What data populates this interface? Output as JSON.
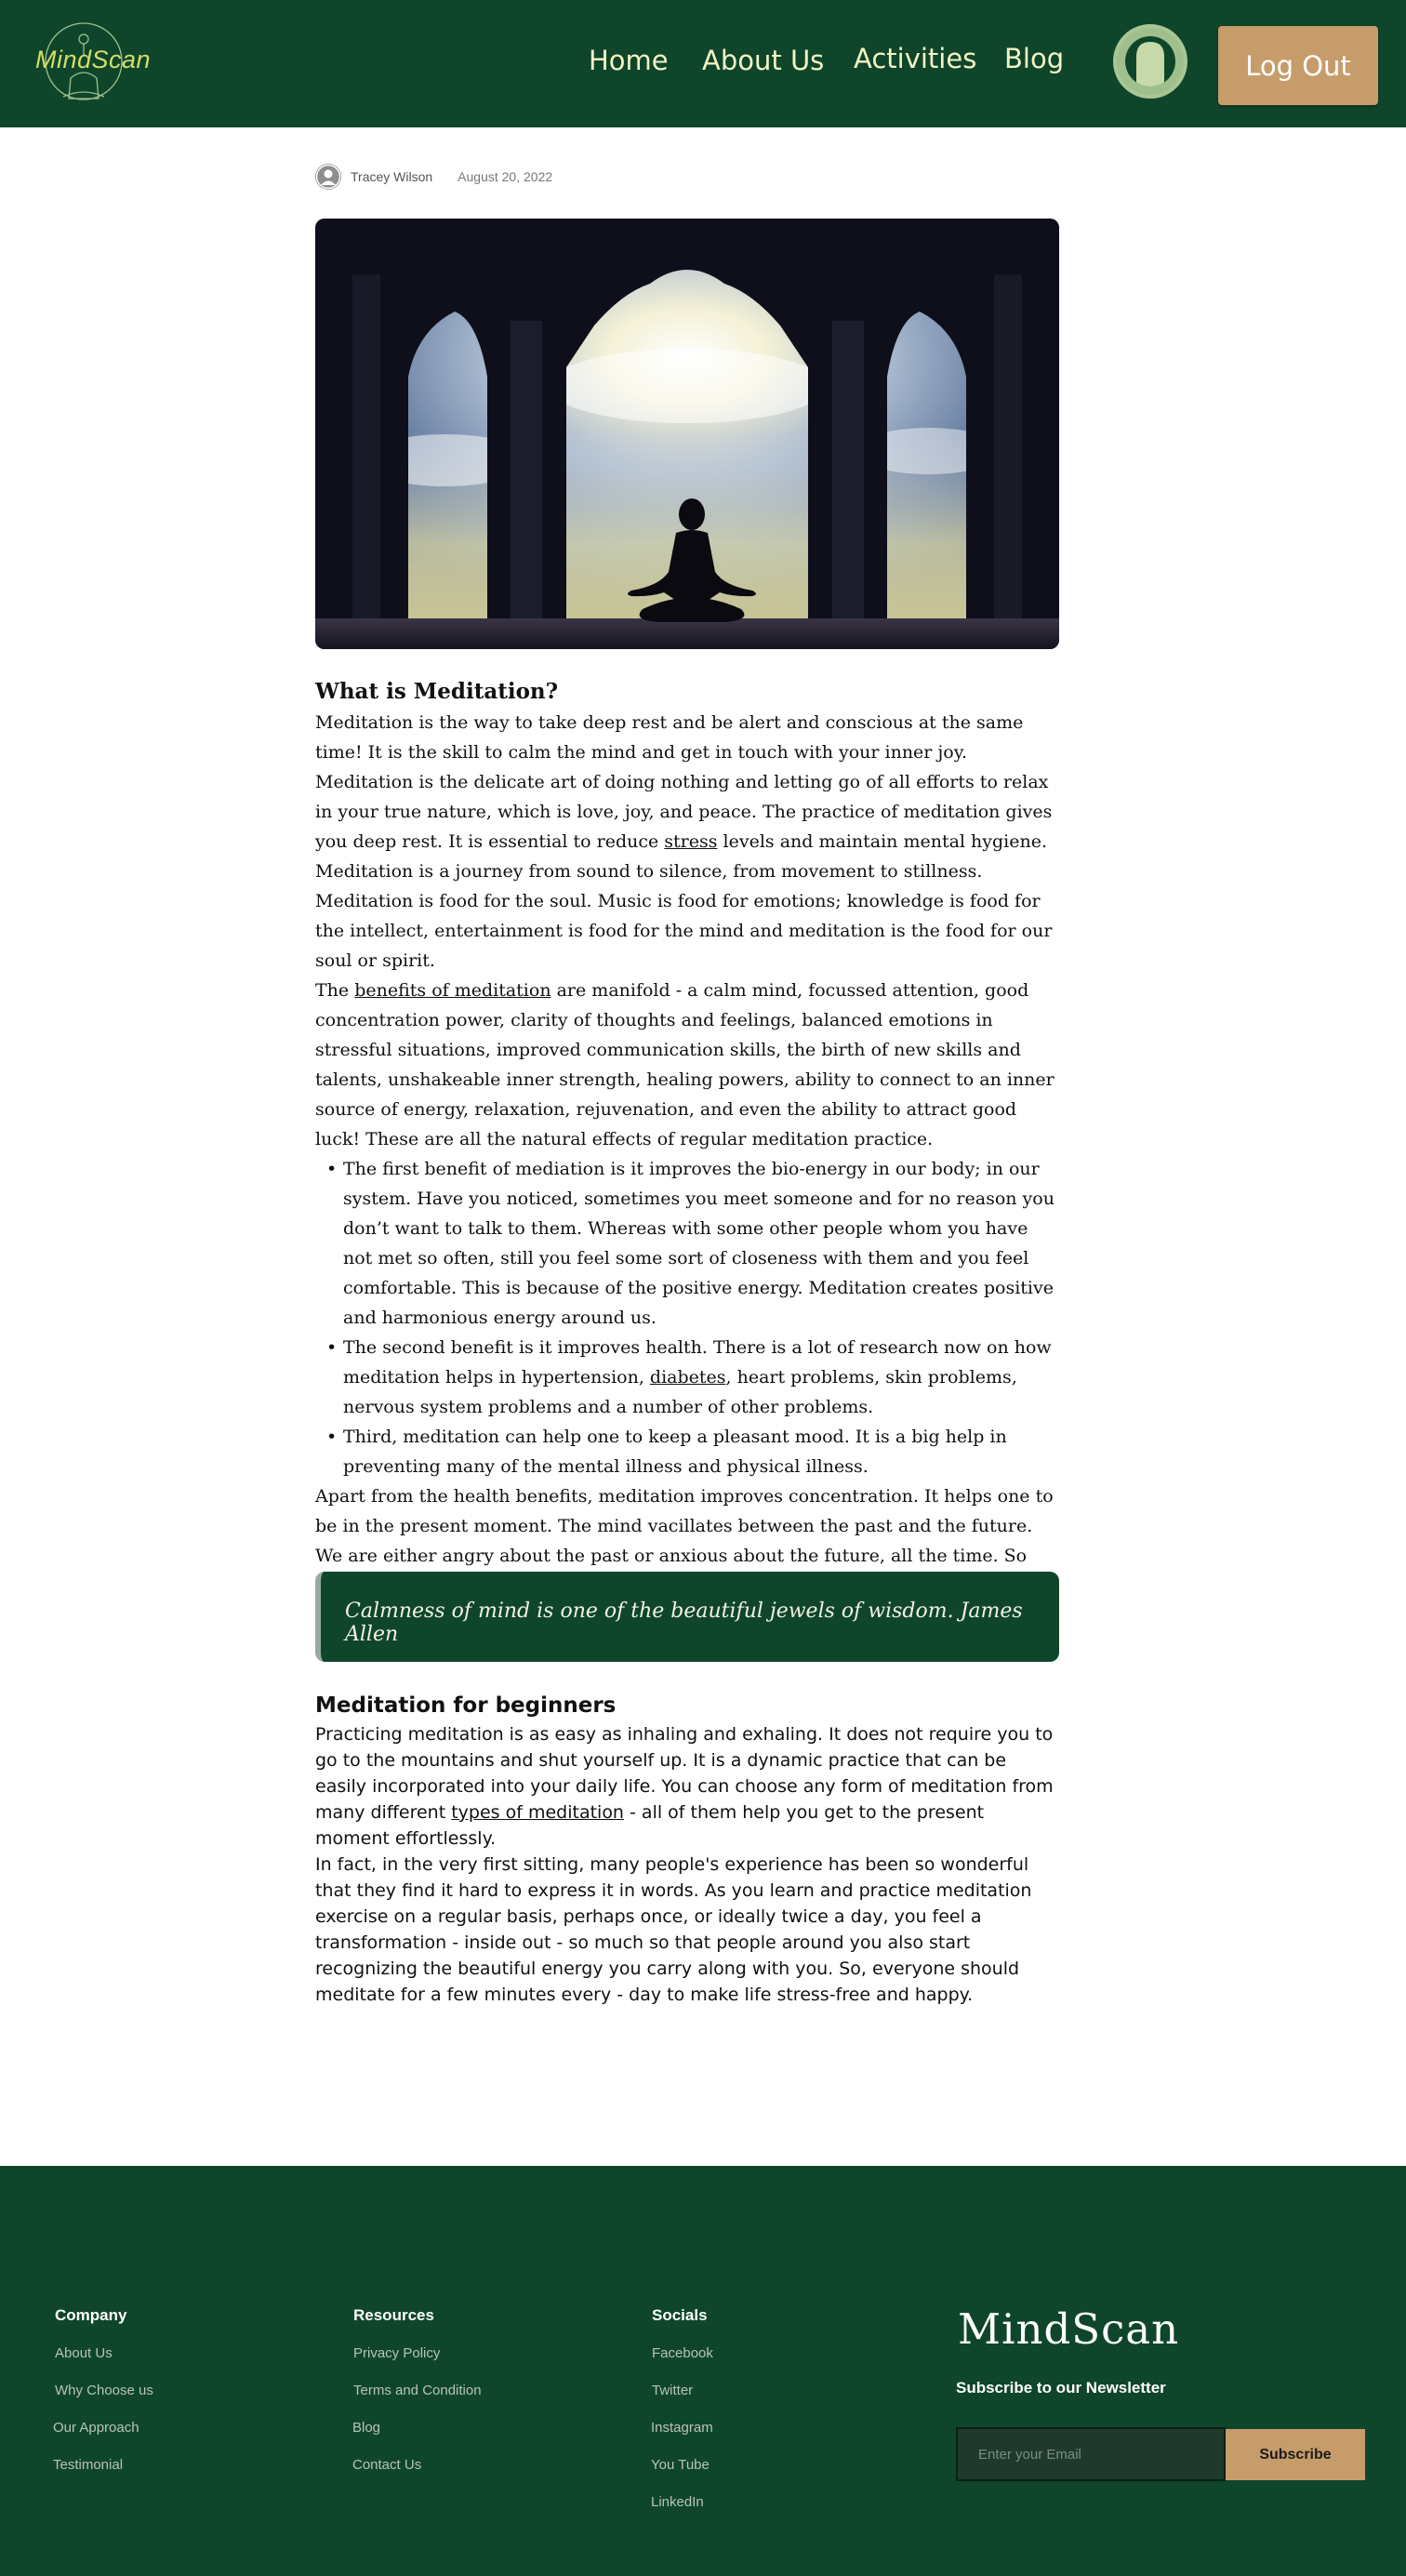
{
  "header": {
    "logo_text": "MindScan",
    "nav": {
      "home": "Home",
      "about": "About Us",
      "activities": "Activities",
      "blog": "Blog"
    },
    "logout_label": "Log Out"
  },
  "post": {
    "author": "Tracey Wilson",
    "date": "August 20, 2022"
  },
  "article": {
    "heading": "What is Meditation?",
    "p1_before": "Meditation is the way to take deep rest and be alert and conscious at the same time! It is the skill to calm the mind and get in touch with your inner joy. Meditation is the delicate art of doing nothing and letting go of all efforts to relax in your true nature, which is love, joy, and peace. The practice of meditation gives you deep rest. It is essential to reduce ",
    "p1_link": "stress",
    "p1_after": " levels and maintain mental hygiene.",
    "p2": "Meditation is a journey from sound to silence, from movement to stillness. Meditation is food for the soul. Music is food for emotions; knowledge is food for the intellect, entertainment is food for the mind and meditation is the food for our soul or spirit.",
    "p3_before": "The ",
    "p3_link": "benefits of meditation",
    "p3_after": " are manifold - a calm mind, focussed attention, good concentration power, clarity of thoughts and feelings, balanced emotions in stressful situations, improved communication skills, the birth of new skills and talents, unshakeable inner strength, healing powers, ability to connect to an inner source of energy, relaxation, rejuvenation, and even the ability to attract good luck! These are all the natural effects of regular meditation practice.",
    "b1": "The first benefit of mediation is it improves the bio-energy in our body; in our system. Have you noticed, sometimes you meet someone and for no reason you don’t want to talk to them. Whereas with some other people whom you have not met so often, still you feel some sort of closeness with them and you feel comfortable. This is because of the positive energy. Meditation creates positive and harmonious energy around us.",
    "b2_before": "The second benefit is it improves health. There is a lot of research now on how meditation helps in hypertension, ",
    "b2_link": "diabetes",
    "b2_after": ", heart problems, skin problems, nervous system problems and a number of other problems.",
    "b3": "Third, meditation can help one to keep a pleasant mood. It is a big help in preventing many of the mental illness and physical illness.",
    "p4": "Apart from the health benefits, meditation improves concentration. It helps one to be in the present moment. The mind vacillates between the past and the future. We are either angry about the past or anxious about the future, all the time. So meditation helps keep the mind from swinging between the past and the future to be more in the present."
  },
  "quote": "Calmness of mind is one of the beautiful jewels of wisdom. James Allen",
  "beginners": {
    "heading": "Meditation for beginners",
    "p1_before": "Practicing meditation is as easy as inhaling and exhaling. It does not require you to go to the mountains and shut yourself up. It is a dynamic practice that can be easily incorporated into your daily life. You can choose any form of meditation from many different ",
    "p1_link": "types of meditation",
    "p1_after": " - all of them help you get to the present moment effortlessly.",
    "p2": "In fact, in the very first sitting, many people's experience has been so wonderful that they find it hard to express it in words. As you learn and practice meditation exercise on a regular basis, perhaps once, or ideally twice a day, you feel a transformation - inside out - so much so that people around you also start recognizing the beautiful energy you carry along with you. So, everyone should meditate for a few minutes every - day to make life stress-free and happy."
  },
  "footer": {
    "company": {
      "title": "Company",
      "links": [
        "About Us",
        "Why Choose us",
        "Our Approach",
        "Testimonial"
      ]
    },
    "resources": {
      "title": "Resources",
      "links": [
        "Privacy Policy",
        "Terms and Condition",
        "Blog",
        "Contact Us"
      ]
    },
    "socials": {
      "title": "Socials",
      "links": [
        "Facebook",
        "Twitter",
        "Instagram",
        "You Tube",
        "LinkedIn"
      ]
    },
    "brand": "MindScan",
    "newsletter_title": "Subscribe to our Newsletter",
    "email_placeholder": "Enter your Email",
    "subscribe_label": "Subscribe"
  },
  "colors": {
    "brand_green": "#0f462b",
    "accent_tan": "#c79c6b",
    "logo_yellow": "#d4dd6a"
  },
  "icons": [
    "mindscan-logo-icon",
    "user-avatar-icon",
    "author-icon"
  ]
}
